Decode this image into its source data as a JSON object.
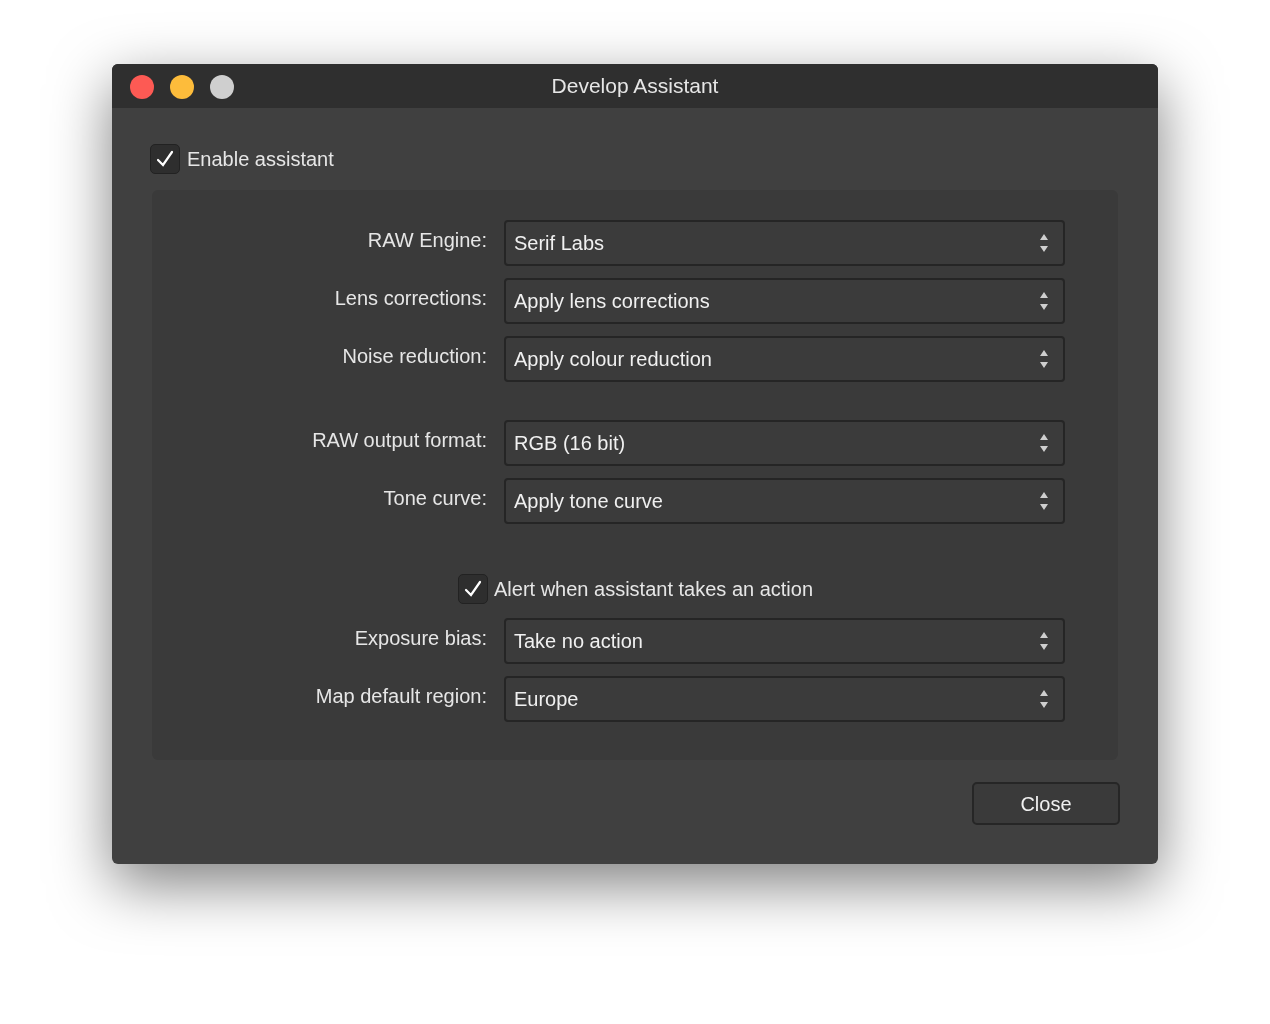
{
  "window": {
    "title": "Develop Assistant"
  },
  "enable_assistant": {
    "label": "Enable assistant",
    "checked": true
  },
  "groups": [
    {
      "rows": [
        {
          "kind": "select",
          "label": "RAW Engine:",
          "value": "Serif Labs"
        },
        {
          "kind": "select",
          "label": "Lens corrections:",
          "value": "Apply lens corrections"
        },
        {
          "kind": "select",
          "label": "Noise reduction:",
          "value": "Apply colour reduction"
        }
      ]
    },
    {
      "rows": [
        {
          "kind": "select",
          "label": "RAW output format:",
          "value": "RGB (16 bit)"
        },
        {
          "kind": "select",
          "label": "Tone curve:",
          "value": "Apply tone curve"
        }
      ]
    },
    {
      "rows": [
        {
          "kind": "checkbox",
          "label": "Alert when assistant takes an action",
          "checked": true
        },
        {
          "kind": "select",
          "label": "Exposure bias:",
          "value": "Take no action"
        },
        {
          "kind": "select",
          "label": "Map default region:",
          "value": "Europe"
        }
      ]
    }
  ],
  "buttons": [
    "Close"
  ]
}
